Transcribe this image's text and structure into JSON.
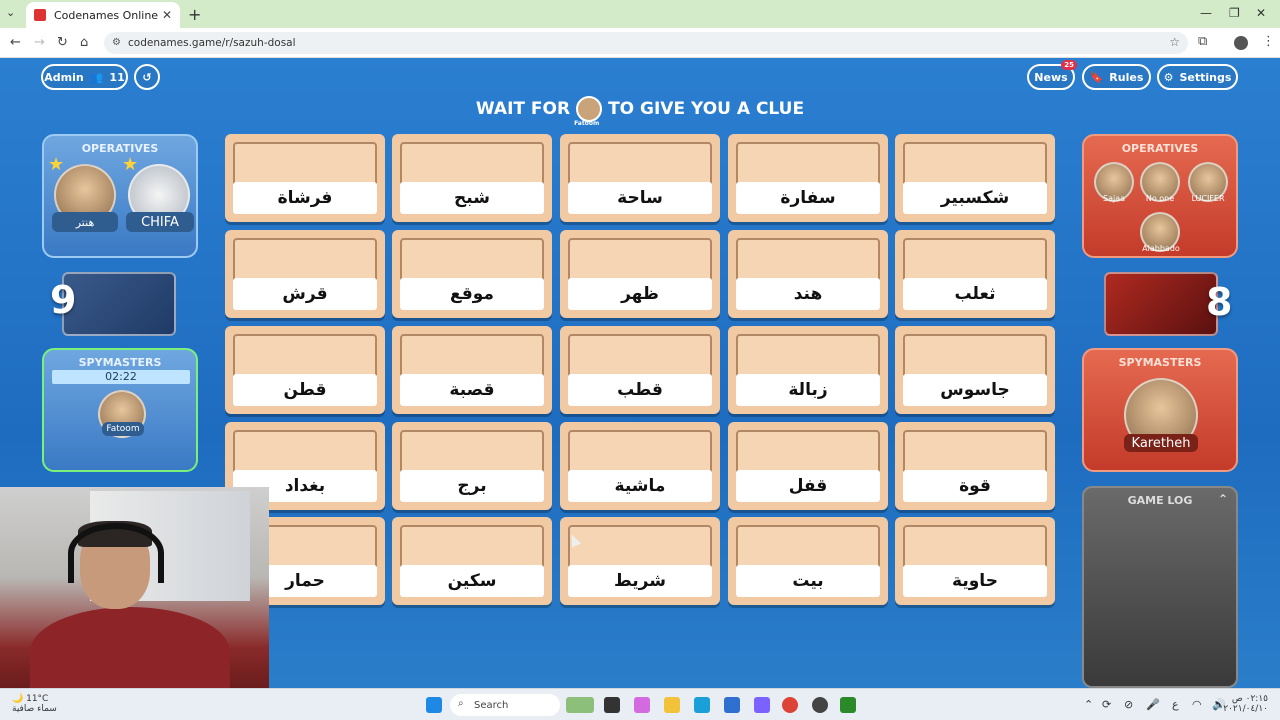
{
  "browser": {
    "tab_title": "Codenames Online",
    "url": "codenames.game/r/sazuh-dosal",
    "new_tab_symbol": "+",
    "tab_close_symbol": "✕"
  },
  "header": {
    "admin_label": "Admin",
    "player_count": "11",
    "news_label": "News",
    "news_badge": "25",
    "rules_label": "Rules",
    "settings_label": "Settings"
  },
  "banner": {
    "before": "WAIT FOR",
    "player": "Fatoom",
    "after": "TO GIVE YOU A CLUE"
  },
  "blue_team": {
    "operatives_title": "OPERATIVES",
    "operatives": [
      "هنتر",
      "CHIFA"
    ],
    "remaining": "9",
    "spymasters_title": "SPYMASTERS",
    "timer": "02:22",
    "spymaster": "Fatoom",
    "color": "#3a79c4"
  },
  "red_team": {
    "operatives_title": "OPERATIVES",
    "operatives": [
      "Sajaa",
      "No one",
      "LUCIFER",
      "Alabbado"
    ],
    "remaining": "8",
    "spymasters_title": "SPYMASTERS",
    "spymaster": "Karetheh",
    "color": "#c43b2a"
  },
  "board": {
    "rows": [
      [
        "فرشاة",
        "شبح",
        "ساحة",
        "سفارة",
        "شكسبير"
      ],
      [
        "قرش",
        "موقع",
        "ظهر",
        "هند",
        "ثعلب"
      ],
      [
        "قطن",
        "قصبة",
        "قطب",
        "زبالة",
        "جاسوس"
      ],
      [
        "بغداد",
        "برج",
        "ماشية",
        "قفل",
        "قوة"
      ],
      [
        "حمار",
        "سكين",
        "شريط",
        "بيت",
        "حاوية"
      ]
    ]
  },
  "game_log": {
    "title": "GAME LOG"
  },
  "taskbar": {
    "temperature": "11°C",
    "weather_text": "سماء صافية",
    "search_placeholder": "Search",
    "time": "٠٢:١٥ ص",
    "date": "٢٠٢١/٠٤/١٠"
  }
}
